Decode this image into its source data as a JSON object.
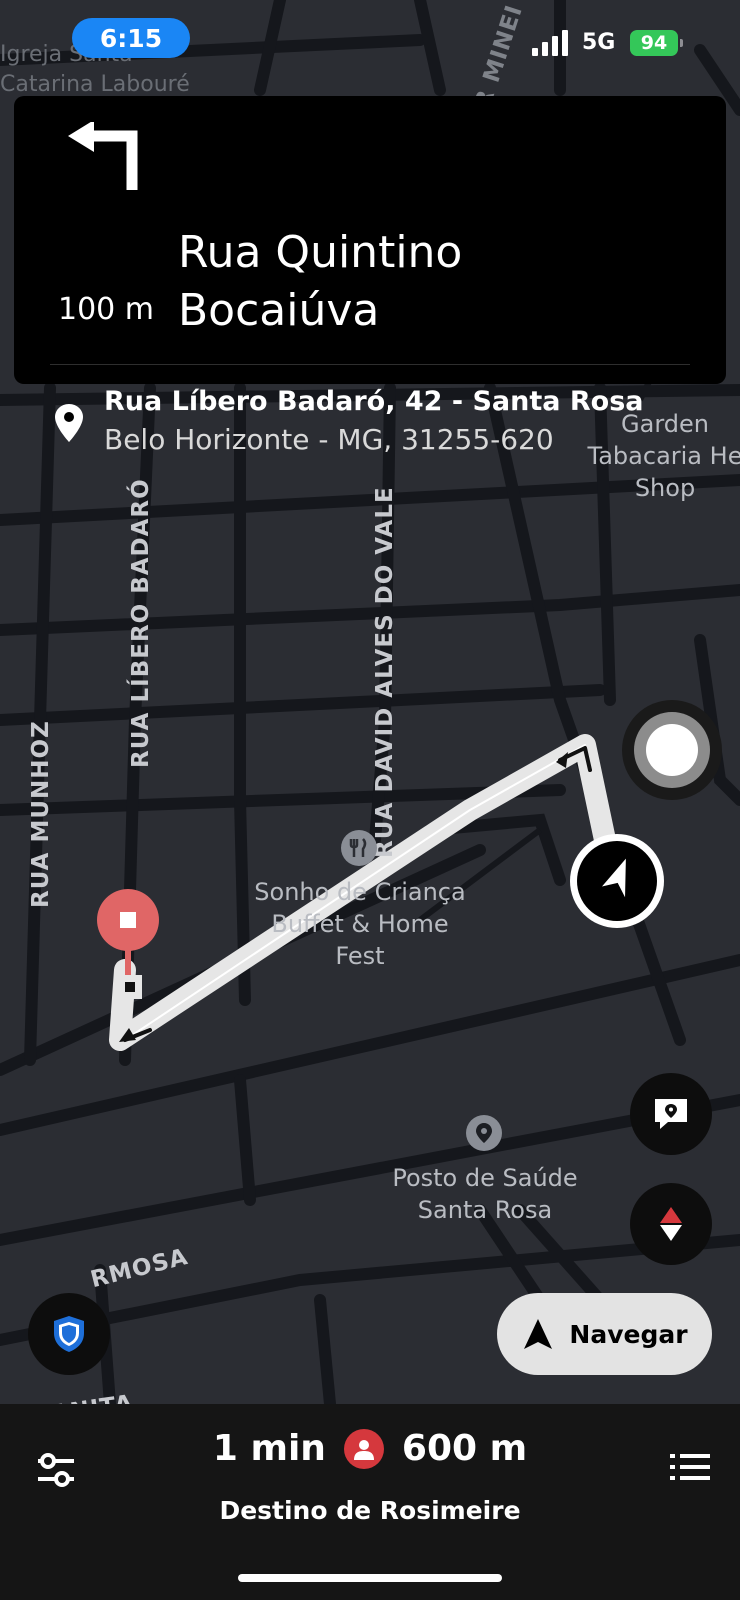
{
  "status_bar": {
    "time": "6:15",
    "network": "5G",
    "battery": "94"
  },
  "maneuver": {
    "icon": "turn-left-icon",
    "distance": "100 m",
    "street_line1": "Rua Quintino",
    "street_line2": "Bocaiúva"
  },
  "destination": {
    "line1": "Rua Líbero Badaró, 42 - Santa Rosa",
    "line2": "Belo Horizonte - MG, 31255-620"
  },
  "map": {
    "streets": [
      "RUA MUNHOZ",
      "RUA LÍBERO BADARÓ",
      "RUA DAVID ALVES DO VALE",
      "RMOSA",
      "ANITA"
    ],
    "map_fragments": [
      "Igreja Santa",
      "Catarina Labouré",
      "R MINEI"
    ],
    "pois": [
      {
        "line1": "Garden",
        "line2": "Tabacaria He",
        "line3": "Shop"
      },
      {
        "line1": "Sonho de Criança",
        "line2": "Buffet & Home",
        "line3": "Fest"
      },
      {
        "line1": "Posto de Saúde",
        "line2": "Santa Rosa"
      }
    ]
  },
  "buttons": {
    "navegar": "Navegar"
  },
  "trip": {
    "eta": "1 min",
    "distance": "600 m",
    "destination_label": "Destino de Rosimeire"
  },
  "colors": {
    "map_bg": "#2b2d33",
    "road": "#15171c",
    "route": "#e6e6e6",
    "pickup_red": "#e06666",
    "status_blue": "#1a86f5",
    "battery_green": "#34c759"
  }
}
